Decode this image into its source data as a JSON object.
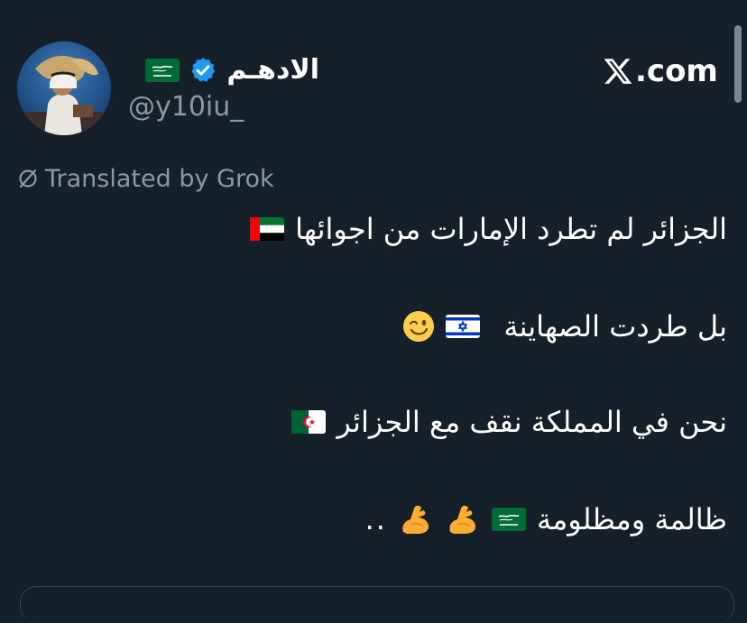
{
  "site": {
    "label": ".com",
    "logo": "x-logo-icon"
  },
  "author": {
    "display_name": "الادهـم",
    "handle": "@y10iu_",
    "verified": true,
    "name_flag": "saudi-flag",
    "avatar": "profile-avatar"
  },
  "translation": {
    "label": "Translated by Grok",
    "icon": "translate-icon"
  },
  "tweet_lines": [
    {
      "text": "الجزائر لم تطرد الإمارات من اجوائها",
      "emojis": [
        "uae-flag"
      ]
    },
    {
      "text": "بل طردت الصهاينة",
      "emojis": [
        "israel-flag",
        "winking-face"
      ]
    },
    {
      "text": "نحن في المملكة نقف مع الجزائر",
      "emojis": [
        "algeria-flag"
      ]
    },
    {
      "text": "ظالمة ومظلومة",
      "emojis": [
        "saudi-flag",
        "flexed-biceps",
        "flexed-biceps"
      ],
      "trailing": ".."
    }
  ],
  "colors": {
    "background": "#15202b",
    "secondary_text": "#8b98a5",
    "verified": "#1d9bf0"
  }
}
